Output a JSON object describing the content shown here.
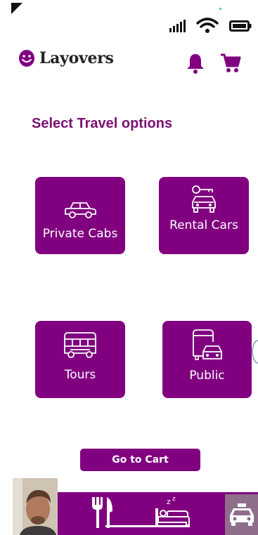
{
  "app": {
    "name": "Layovers"
  },
  "header": {
    "icons": [
      "smiley-logo-icon",
      "bell-icon",
      "cart-icon"
    ]
  },
  "status_bar": {
    "icons": [
      "cellular-signal-icon",
      "wifi-icon",
      "battery-icon"
    ]
  },
  "section": {
    "title": "Select Travel options"
  },
  "options": [
    {
      "label": "Private Cabs",
      "icon": "car-icon"
    },
    {
      "label": "Rental Cars",
      "icon": "car-key-icon"
    },
    {
      "label": "Tours",
      "icon": "tour-bus-icon"
    },
    {
      "label": "Public",
      "icon": "public-transit-icon"
    }
  ],
  "cart_button": {
    "label": "Go to Cart"
  },
  "bottom_nav": {
    "items": [
      "dining-icon",
      "sleep-icon",
      "taxi-icon"
    ]
  },
  "colors": {
    "primary": "#800080",
    "title": "#7a1174",
    "taxi_tab": "#8e6e8b"
  }
}
